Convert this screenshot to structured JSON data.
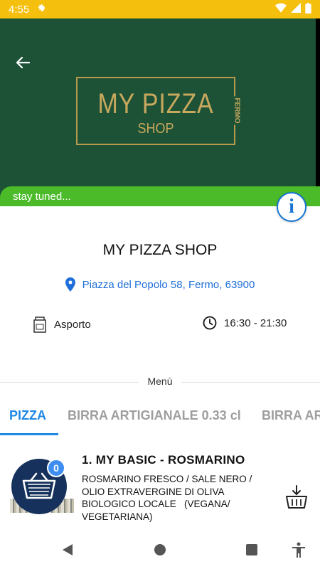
{
  "status_bar": {
    "time": "4:55",
    "icons": [
      "gear-icon",
      "wifi-icon",
      "signal-icon",
      "battery-icon"
    ],
    "color": "#f5bf0e"
  },
  "hero": {
    "logo_title": "MY PIZZA",
    "logo_subtitle": "SHOP",
    "logo_city": "FERMO",
    "background_color": "#1d5236",
    "accent_color": "#c7a85d"
  },
  "banner": {
    "text": "stay tuned...",
    "color": "#4bbb2a"
  },
  "shop": {
    "name": "MY PIZZA SHOP",
    "address": "Piazza del Popolo 58, Fermo, 63900",
    "service": "Asporto",
    "hours": "16:30 - 21:30"
  },
  "menu": {
    "label": "Menù",
    "tabs": [
      {
        "label": "PIZZA",
        "active": true
      },
      {
        "label": "BIRRA ARTIGIANALE 0.33 cl",
        "active": false
      },
      {
        "label": "BIRRA ARTIGIANALE",
        "active": false
      }
    ]
  },
  "products": [
    {
      "title": "1. MY BASIC - ROSMARINO",
      "description": "ROSMARINO FRESCO / SALE NERO /\nOLIO EXTRAVERGINE DI OLIVA\nBIOLOGICO LOCALE   (VEGANA/\nVEGETARIANA)",
      "cart_count": "0"
    }
  ],
  "colors": {
    "link": "#1e6fd9",
    "tab_active": "#1e88e5",
    "badge": "#3d8ef0"
  }
}
